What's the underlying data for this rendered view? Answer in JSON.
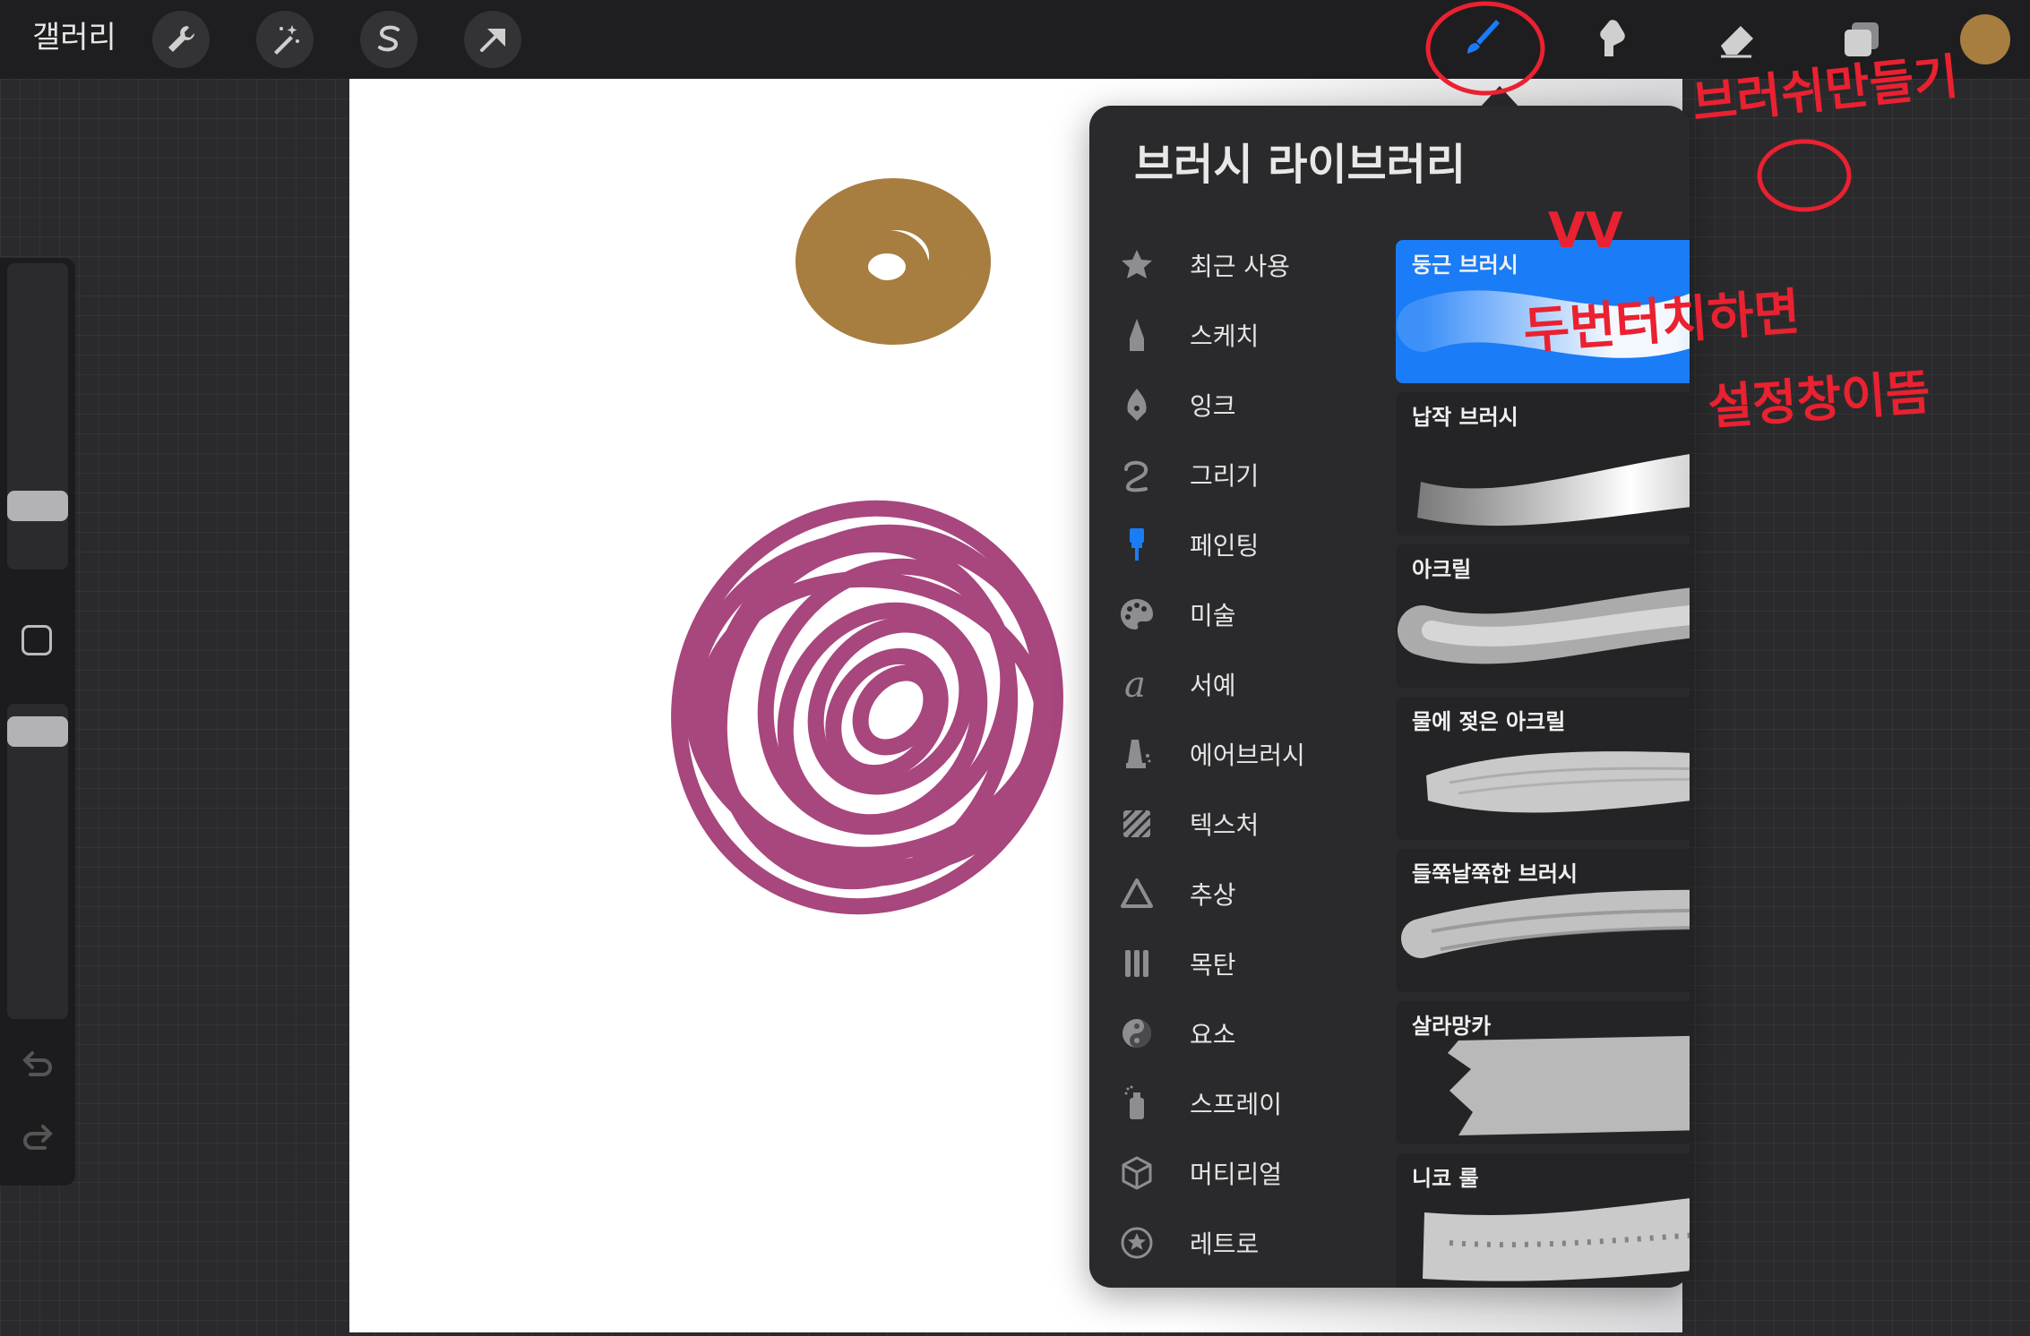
{
  "toolbar": {
    "gallery_label": "갤러리",
    "left_tools": [
      {
        "name": "wrench-icon"
      },
      {
        "name": "magic-wand-icon"
      },
      {
        "name": "selection-s-icon"
      },
      {
        "name": "transform-arrow-icon"
      }
    ],
    "right_tools": [
      {
        "name": "brush-icon",
        "active": true
      },
      {
        "name": "smudge-icon"
      },
      {
        "name": "eraser-icon"
      },
      {
        "name": "layers-icon"
      }
    ],
    "current_color": "#a87d40"
  },
  "colors": {
    "accent": "#1a7cf7",
    "annotation_red": "#ea2130",
    "stroke_gold": "#a87d40",
    "stroke_magenta": "#a8467e"
  },
  "brush_library": {
    "title": "브러시 라이브러리",
    "add_icon": "plus-icon",
    "categories": [
      {
        "label": "최근 사용",
        "icon": "star-icon"
      },
      {
        "label": "스케치",
        "icon": "pencil-tip-icon"
      },
      {
        "label": "잉크",
        "icon": "pen-nib-icon"
      },
      {
        "label": "그리기",
        "icon": "squiggle-icon"
      },
      {
        "label": "페인팅",
        "icon": "paintbrush-icon",
        "active": true
      },
      {
        "label": "미술",
        "icon": "palette-icon"
      },
      {
        "label": "서예",
        "icon": "calligraphy-a-icon"
      },
      {
        "label": "에어브러시",
        "icon": "airbrush-icon"
      },
      {
        "label": "텍스처",
        "icon": "texture-icon"
      },
      {
        "label": "추상",
        "icon": "triangle-icon"
      },
      {
        "label": "목탄",
        "icon": "charcoal-icon"
      },
      {
        "label": "요소",
        "icon": "yin-yang-icon"
      },
      {
        "label": "스프레이",
        "icon": "spray-can-icon"
      },
      {
        "label": "머티리얼",
        "icon": "cube-icon"
      },
      {
        "label": "레트로",
        "icon": "retro-star-icon"
      }
    ],
    "brushes": [
      {
        "label": "둥근 브러시",
        "selected": true
      },
      {
        "label": "납작 브러시"
      },
      {
        "label": "아크릴"
      },
      {
        "label": "물에 젖은 아크릴"
      },
      {
        "label": "들쭉날쭉한 브러시"
      },
      {
        "label": "살라망카"
      },
      {
        "label": "니코 룰"
      }
    ]
  },
  "sidebar": {
    "modify_icon": "square-icon",
    "undo_icon": "undo-icon",
    "redo_icon": "redo-icon"
  },
  "annotations": {
    "note_create": "브러쉬만들기",
    "note_vv": "VV",
    "note_double_tap": "두번터치하면",
    "note_settings": "설정창이뜸"
  }
}
